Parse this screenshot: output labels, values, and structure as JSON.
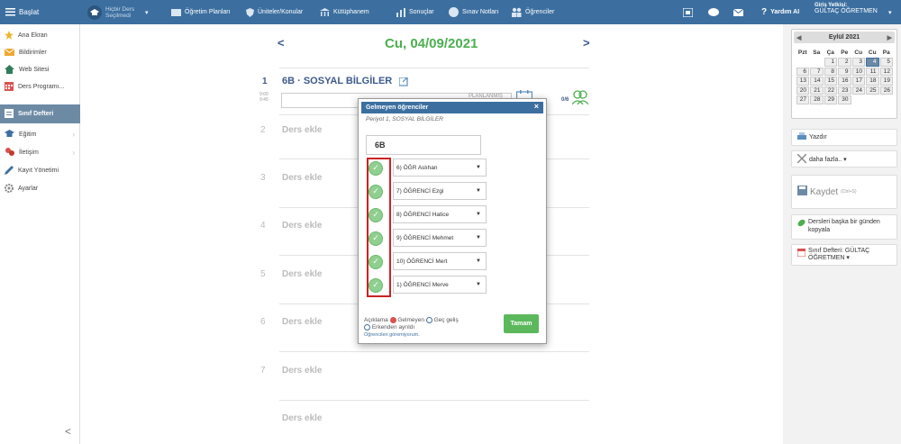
{
  "topbar": {
    "start": "Başlat",
    "course_selector": "Hiçbir Ders Seçilmedi",
    "menu": [
      "Öğretim Planları",
      "Üniteler/Konular",
      "Kütüphanem",
      "Sonuçlar",
      "Sınav Notları",
      "Öğrenciler"
    ],
    "help": "Yardım AI",
    "login_label": "Giriş Yetkisi:",
    "login_user": "GÜLTAÇ ÖĞRETMEN"
  },
  "sidebar": {
    "items": [
      {
        "label": "Ana Ekran",
        "icon": "star-icon"
      },
      {
        "label": "Bildirimler",
        "icon": "envelope-icon"
      },
      {
        "label": "Web Sitesi",
        "icon": "home-icon"
      },
      {
        "label": "Ders Programı...",
        "icon": "calendar-grid-icon"
      },
      {
        "label": "Sınıf Defteri",
        "icon": "notebook-icon"
      },
      {
        "label": "Eğitim",
        "icon": "cap-icon"
      },
      {
        "label": "İletişim",
        "icon": "people-icon"
      },
      {
        "label": "Kayıt Yönetimi",
        "icon": "pencil-icon"
      },
      {
        "label": "Ayarlar",
        "icon": "gear-icon"
      }
    ],
    "collapse": "<"
  },
  "main": {
    "date": "Cu, 04/09/2021",
    "prev": "<",
    "next": ">",
    "lesson": {
      "number": "1",
      "title": "6B · SOSYAL BİLGİLER",
      "time_start": "9:00",
      "time_end": "9:45",
      "planned_label": "PLANLANMIŞ",
      "attendance": "0/6"
    },
    "slots": [
      {
        "num": "2",
        "label": "Ders ekle"
      },
      {
        "num": "3",
        "label": "Ders ekle"
      },
      {
        "num": "4",
        "label": "Ders ekle"
      },
      {
        "num": "5",
        "label": "Ders ekle"
      },
      {
        "num": "6",
        "label": "Ders ekle"
      },
      {
        "num": "7",
        "label": "Ders ekle"
      },
      {
        "num": "",
        "label": "Ders ekle"
      }
    ]
  },
  "modal": {
    "title": "Gelmeyen öğrenciler",
    "close": "×",
    "subtitle": "Periyot 1, SOSYAL BİLGİLER",
    "class_name": "6B",
    "students": [
      "6) ÖĞR Aslıhan",
      "7) ÖĞRENCİ Ezgi",
      "8) ÖĞRENCİ Hatice",
      "9) ÖĞRENCİ Mehmet",
      "10) ÖĞRENCİ Mert",
      "1) ÖĞRENCİ Merve"
    ],
    "legend_label": "Açıklama",
    "legend_absent": "Gelmeyen",
    "legend_late": "Geç geliş",
    "legend_left": "Erkenden ayrıldı",
    "link": "Öğrencileri göremiyorum.",
    "ok_button": "Tamam"
  },
  "calendar": {
    "month": "Eylül 2021",
    "day_names": [
      "Pzt",
      "Sa",
      "Ça",
      "Pe",
      "Cu",
      "Cu",
      "Pa"
    ],
    "weeks": [
      [
        "",
        "",
        "1",
        "2",
        "3",
        "4",
        "5"
      ],
      [
        "6",
        "7",
        "8",
        "9",
        "10",
        "11",
        "12"
      ],
      [
        "13",
        "14",
        "15",
        "16",
        "17",
        "18",
        "19"
      ],
      [
        "20",
        "21",
        "22",
        "23",
        "24",
        "25",
        "26"
      ],
      [
        "27",
        "28",
        "29",
        "30",
        "",
        "",
        ""
      ]
    ],
    "selected": "4"
  },
  "right_panel": {
    "print": "Yazdır",
    "more": "daha fazla.. ▾",
    "save": "Kaydet",
    "save_shortcut": "(Ctrl+S)",
    "copy": "Dersleri başka bir günden kopyala",
    "notebook": "Sınıf Defteri: GÜLTAÇ ÖĞRETMEN ▾"
  },
  "colors": {
    "topbar": "#3c6fa0",
    "active_sidebar": "#6d8aa5",
    "date_green": "#4caf50",
    "lesson_blue": "#3c5a8c",
    "ok_button": "#5cb85c",
    "absent_highlight": "#cc2222"
  }
}
